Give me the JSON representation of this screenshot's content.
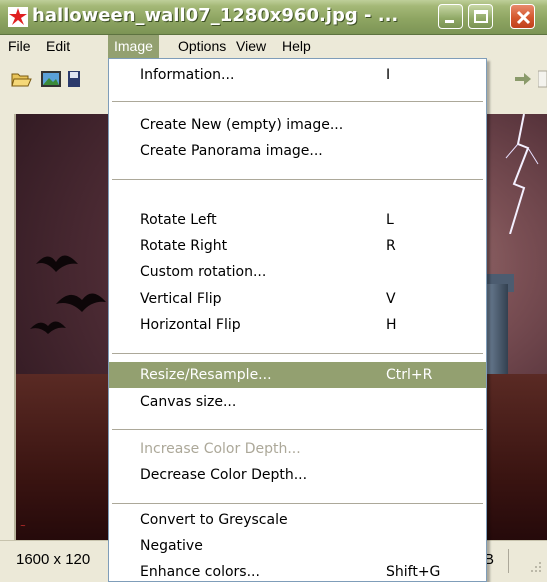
{
  "window": {
    "title": "halloween_wall07_1280x960.jpg - ..."
  },
  "menubar": {
    "items": [
      {
        "label": "File"
      },
      {
        "label": "Edit"
      },
      {
        "label": "Image"
      },
      {
        "label": "Options"
      },
      {
        "label": "View"
      },
      {
        "label": "Help"
      }
    ],
    "active": "Image"
  },
  "image_menu": {
    "items": [
      {
        "label": "Information...",
        "shortcut": "I"
      },
      {
        "label": "Create New (empty) image...",
        "shortcut": ""
      },
      {
        "label": "Create Panorama image...",
        "shortcut": ""
      },
      {
        "label": "Rotate Left",
        "shortcut": "L"
      },
      {
        "label": "Rotate Right",
        "shortcut": "R"
      },
      {
        "label": "Custom rotation...",
        "shortcut": ""
      },
      {
        "label": "Vertical Flip",
        "shortcut": "V"
      },
      {
        "label": "Horizontal Flip",
        "shortcut": "H"
      },
      {
        "label": "Resize/Resample...",
        "shortcut": "Ctrl+R",
        "highlighted": true
      },
      {
        "label": "Canvas size...",
        "shortcut": ""
      },
      {
        "label": "Increase Color Depth...",
        "shortcut": "",
        "disabled": true
      },
      {
        "label": "Decrease Color Depth...",
        "shortcut": ""
      },
      {
        "label": "Convert to Greyscale",
        "shortcut": ""
      },
      {
        "label": "Negative",
        "shortcut": ""
      },
      {
        "label": "Enhance colors...",
        "shortcut": "Shift+G"
      }
    ]
  },
  "statusbar": {
    "dimensions": "1600 x 120",
    "right_text": "B"
  },
  "colors": {
    "titlebar": "#8ea562",
    "menu_highlight": "#93a070",
    "close_button": "#d4572e"
  }
}
